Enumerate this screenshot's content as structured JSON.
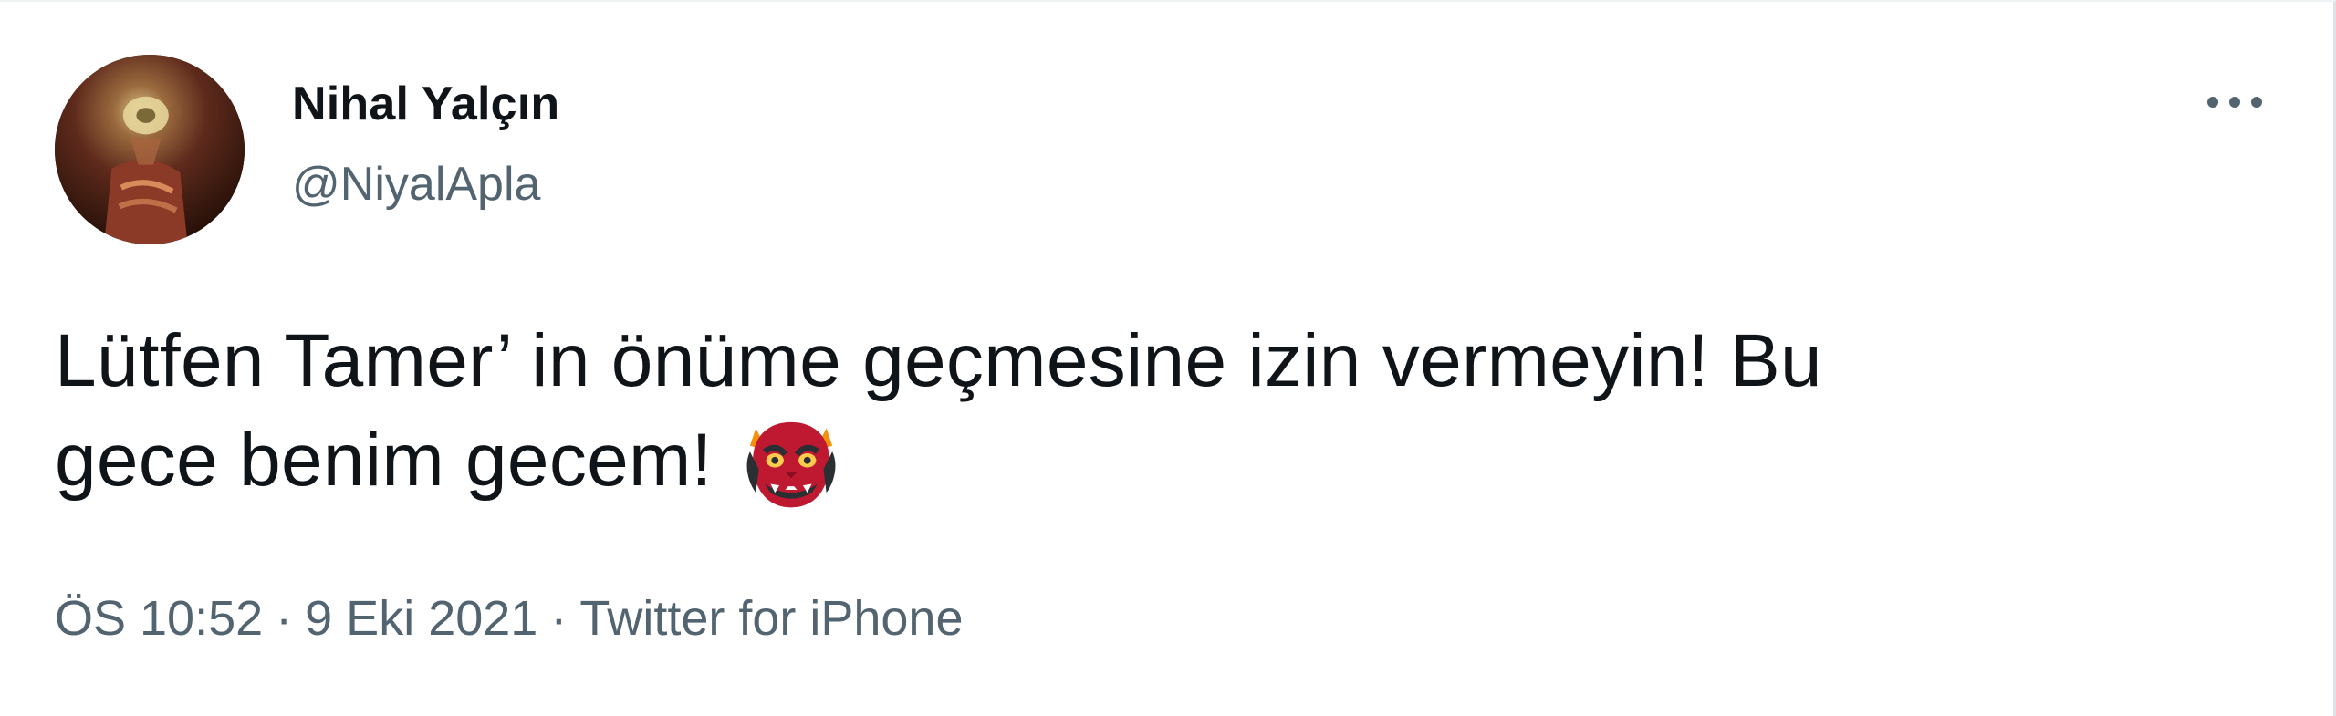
{
  "tweet": {
    "author": {
      "display_name": "Nihal Yalçın",
      "handle": "@NiyalApla",
      "avatar_icon": "profile-photo"
    },
    "more_icon": "more-dots-icon",
    "text_line1": "Lütfen Tamer’ in önüme geçmesine izin vermeyin! Bu",
    "text_line2": "gece benim gecem!",
    "emoji": "ogre-emoji",
    "time": "ÖS 10:52",
    "date": "9 Eki 2021",
    "source": "Twitter for iPhone",
    "separator": "·"
  },
  "colors": {
    "text_primary": "#0f1419",
    "text_secondary": "#536471",
    "background": "#ffffff"
  }
}
